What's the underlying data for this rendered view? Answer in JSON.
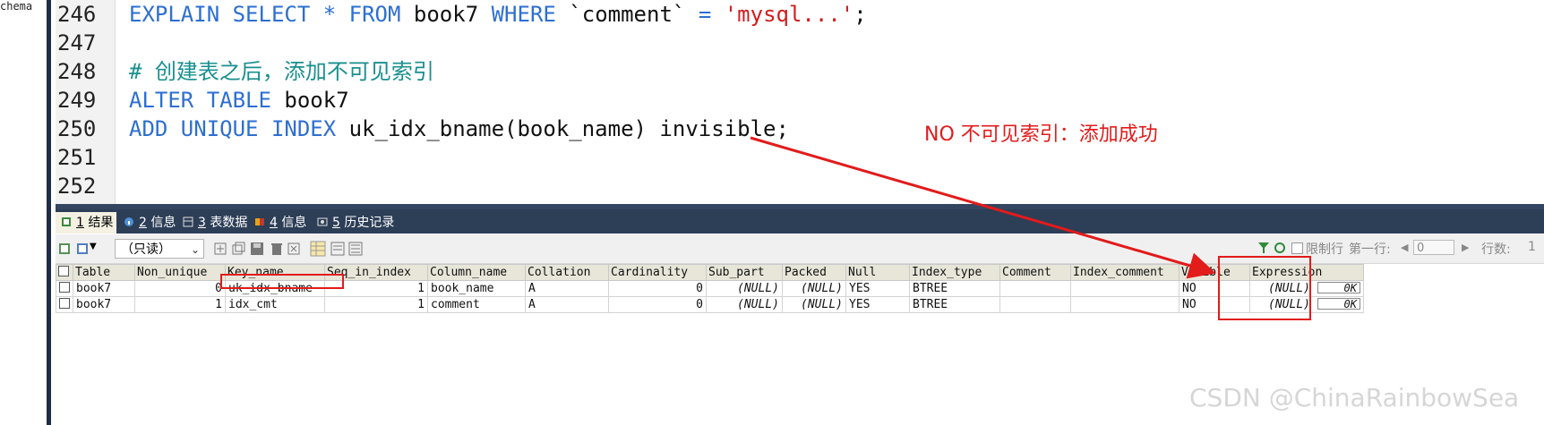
{
  "left_panel": {
    "schema_text": "chema"
  },
  "editor": {
    "lines": [
      {
        "num": "246",
        "parts": [
          {
            "t": "EXPLAIN SELECT",
            "c": "kw"
          },
          {
            "t": " ",
            "c": ""
          },
          {
            "t": "*",
            "c": "kw"
          },
          {
            "t": " ",
            "c": ""
          },
          {
            "t": "FROM",
            "c": "kw"
          },
          {
            "t": " book7 ",
            "c": ""
          },
          {
            "t": "WHERE",
            "c": "kw"
          },
          {
            "t": " `comment` ",
            "c": ""
          },
          {
            "t": "=",
            "c": "kw"
          },
          {
            "t": " ",
            "c": ""
          },
          {
            "t": "'mysql...'",
            "c": "str"
          },
          {
            "t": ";",
            "c": ""
          }
        ]
      },
      {
        "num": "247",
        "parts": []
      },
      {
        "num": "248",
        "parts": [
          {
            "t": "# 创建表之后，添加不可见索引",
            "c": "cmt"
          }
        ]
      },
      {
        "num": "249",
        "parts": [
          {
            "t": "ALTER TABLE",
            "c": "kw"
          },
          {
            "t": " book7",
            "c": ""
          }
        ]
      },
      {
        "num": "250",
        "parts": [
          {
            "t": "ADD UNIQUE INDEX",
            "c": "kw"
          },
          {
            "t": " uk_idx_bname(book_name) invisible;",
            "c": ""
          }
        ]
      },
      {
        "num": "251",
        "parts": []
      },
      {
        "num": "252",
        "parts": []
      }
    ]
  },
  "tabs": [
    {
      "num": "1",
      "label": "结果",
      "active": true
    },
    {
      "num": "2",
      "label": "信息",
      "active": false
    },
    {
      "num": "3",
      "label": "表数据",
      "active": false
    },
    {
      "num": "4",
      "label": "信息",
      "active": false
    },
    {
      "num": "5",
      "label": "历史记录",
      "active": false
    }
  ],
  "toolbar": {
    "readonly_label": "（只读）",
    "limit_label": "限制行",
    "first_row_label": "第一行:",
    "first_row_value": "0",
    "rows_label": "行数:",
    "rows_value": "1"
  },
  "grid": {
    "columns": [
      "Table",
      "Non_unique",
      "Key_name",
      "Seq_in_index",
      "Column_name",
      "Collation",
      "Cardinality",
      "Sub_part",
      "Packed",
      "Null",
      "Index_type",
      "Comment",
      "Index_comment",
      "Visible",
      "Expression"
    ],
    "rows": [
      [
        "book7",
        "0",
        "uk_idx_bname",
        "1",
        "book_name",
        "A",
        "0",
        "(NULL)",
        "(NULL)",
        "YES",
        "BTREE",
        "",
        "",
        "NO",
        "(NULL)"
      ],
      [
        "book7",
        "1",
        "idx_cmt",
        "1",
        "comment",
        "A",
        "0",
        "(NULL)",
        "(NULL)",
        "YES",
        "BTREE",
        "",
        "",
        "NO",
        "(NULL)"
      ]
    ],
    "ok_label": "0K"
  },
  "annotation": {
    "text": "NO 不可见索引：添加成功",
    "color": "#e21b1b"
  },
  "watermark": "CSDN @ChinaRainbowSea"
}
